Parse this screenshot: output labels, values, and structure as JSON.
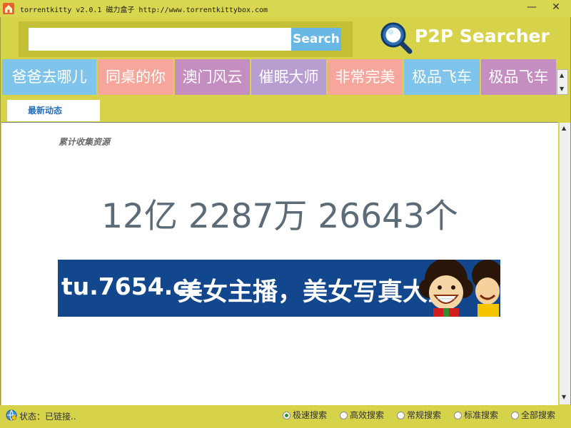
{
  "window": {
    "title": "torrentkitty v2.0.1 磁力盒子 http://www.torrentkittybox.com",
    "minimize_glyph": "—",
    "close_glyph": "✕",
    "app_icon": "home-icon"
  },
  "search": {
    "value": "",
    "placeholder": "",
    "button_label": "Search"
  },
  "logo": {
    "icon": "magnifier-icon",
    "text": "P2P Searcher"
  },
  "hot_tags": [
    {
      "label": "爸爸去哪儿",
      "color": "#7fc4ea"
    },
    {
      "label": "同桌的你",
      "color": "#f7a69c"
    },
    {
      "label": "澳门风云",
      "color": "#c58ec0"
    },
    {
      "label": "催眠大师",
      "color": "#b89ed0"
    },
    {
      "label": "非常完美",
      "color": "#f7a69c"
    },
    {
      "label": "极品飞车",
      "color": "#7fc4ea"
    },
    {
      "label": "极品飞车",
      "color": "#c58ec0"
    }
  ],
  "tabs": [
    {
      "label": "最新动态",
      "active": true
    }
  ],
  "content": {
    "label": "累计收集资源",
    "count": "12亿 2287万 26643个"
  },
  "banner": {
    "domain": "tu.7654.cc",
    "slogan": "美女主播，美女写真大全"
  },
  "status": {
    "text": "状态：已链接.."
  },
  "search_modes": [
    {
      "label": "极速搜索",
      "selected": true
    },
    {
      "label": "高效搜索",
      "selected": false
    },
    {
      "label": "常规搜索",
      "selected": false
    },
    {
      "label": "标准搜索",
      "selected": false
    },
    {
      "label": "全部搜索",
      "selected": false
    }
  ],
  "colors": {
    "chrome": "#d6d24a",
    "accent_blue": "#69b7e3",
    "banner_bg": "#12478d",
    "count_text": "#5b6c78"
  }
}
